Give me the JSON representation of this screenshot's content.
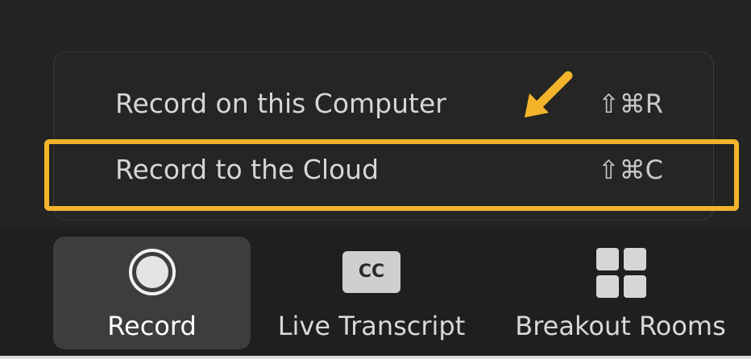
{
  "menu": {
    "items": [
      {
        "label": "Record on this Computer",
        "shortcut": "⇧⌘R"
      },
      {
        "label": "Record to the Cloud",
        "shortcut": "⇧⌘C"
      }
    ]
  },
  "annotation": {
    "highlight_color": "#f3b42b",
    "arrow_icon": "arrow-down-left-icon",
    "highlighted_item": "Record to the Cloud"
  },
  "toolbar": {
    "record_label": "Record",
    "record_icon": "record-icon",
    "transcript_label": "Live Transcript",
    "transcript_icon_text": "CC",
    "breakout_label": "Breakout Rooms",
    "breakout_icon": "grid-icon"
  },
  "colors": {
    "background": "#232323",
    "menu_background": "#252525",
    "toolbar_background": "#1f1f1f",
    "active_tool_background": "#3d3d3d",
    "text": "#d6d6d6"
  }
}
